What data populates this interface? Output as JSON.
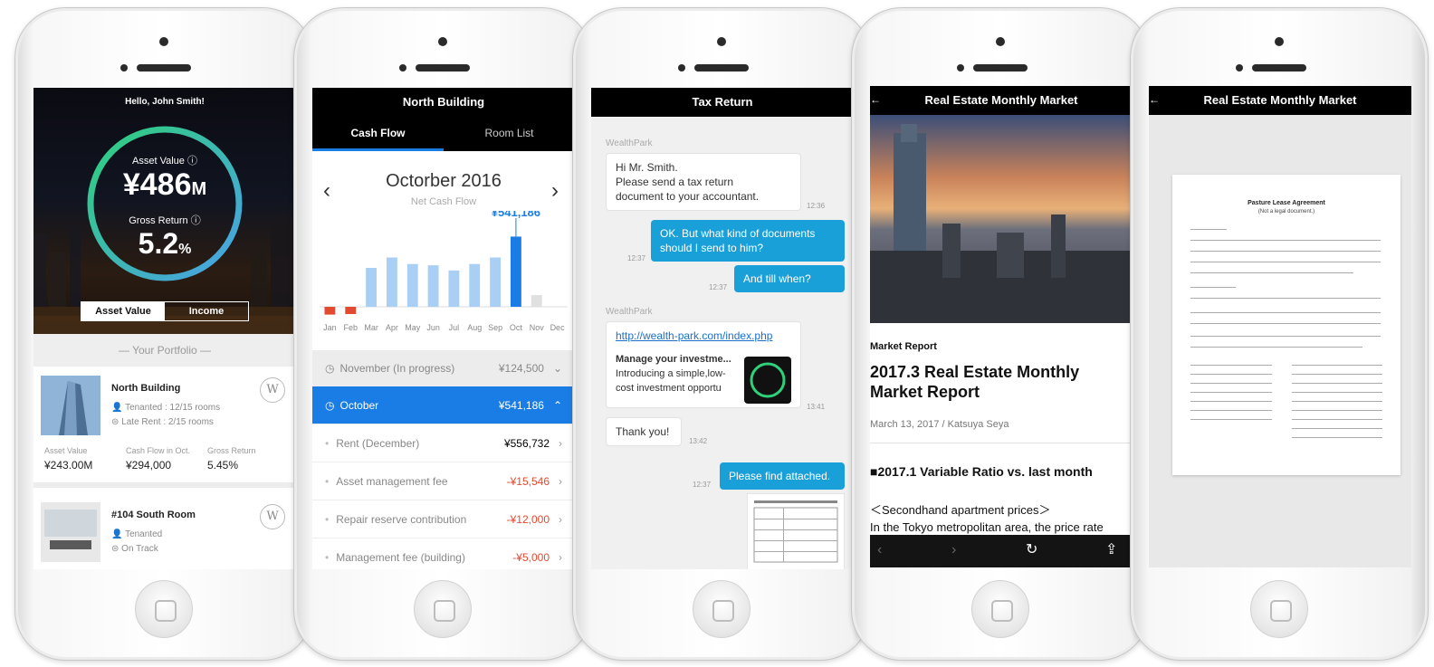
{
  "screens": {
    "portfolio": {
      "greeting": "Hello, John Smith!",
      "asset_value_label": "Asset Value",
      "asset_value": "¥486",
      "asset_value_unit": "M",
      "gross_return_label": "Gross Return",
      "gross_return": "5.2",
      "gross_return_unit": "%",
      "toggle": [
        "Asset Value",
        "Income"
      ],
      "section_title": "Your Portfolio",
      "properties": [
        {
          "name": "North Building",
          "line1": "Tenanted : 12/15 rooms",
          "line2": "Late Rent : 2/15 rooms",
          "stats": [
            {
              "k": "Asset Value",
              "v": "¥243.00M"
            },
            {
              "k": "Cash Flow in Oct.",
              "v": "¥294,000"
            },
            {
              "k": "Gross Return",
              "v": "5.45%"
            }
          ]
        },
        {
          "name": "#104 South Room",
          "line1": "Tenanted",
          "line2": "On Track"
        }
      ]
    },
    "cashflow": {
      "title": "North Building",
      "tabs": [
        "Cash Flow",
        "Room List"
      ],
      "month": "Octorber 2016",
      "subtitle": "Net Cash Flow",
      "callout": "¥541,186",
      "rows": [
        {
          "label": "November (In progress)",
          "value": "¥124,500"
        },
        {
          "label": "October",
          "value": "¥541,186"
        },
        {
          "label": "Rent (December)",
          "value": "¥556,732"
        },
        {
          "label": "Asset management fee",
          "value": "-¥15,546"
        },
        {
          "label": "Repair reserve contribution",
          "value": "-¥12,000"
        },
        {
          "label": "Management fee (building)",
          "value": "-¥5,000"
        }
      ]
    },
    "chat": {
      "title": "Tax Return",
      "sender": "WealthPark",
      "m1": "Hi Mr. Smith.",
      "m1b": "Please send a tax return",
      "m1c": "document to your accountant.",
      "t1": "12:36",
      "m2": "OK. But what kind of documents",
      "m2b": "should I send to him?",
      "t2": "12:37",
      "m3": "And till when?",
      "t3": "12:37",
      "link": "http://wealth-park.com/index.php",
      "preview_title": "Manage your investme...",
      "preview_body1": "Introducing a simple,low-",
      "preview_body2": "cost investment opportu",
      "t4": "13:41",
      "m5": "Thank you!",
      "t5": "13:42",
      "m6": "Please find attached.",
      "t6": "12:37"
    },
    "article": {
      "title": "Real Estate Monthly Market",
      "kicker": "Market Report",
      "headline1": "2017.3 Real Estate Monthly",
      "headline2": "Market Report",
      "byline": "March 13, 2017 / Katsuya Seya",
      "section": "■2017.1 Variable Ratio vs. last month",
      "p1": "＜Secondhand apartment prices＞",
      "p2": "In the Tokyo metropolitan area, the price rate"
    },
    "document": {
      "title": "Real Estate Monthly Market",
      "doc_title": "Pasture Lease Agreement",
      "doc_sub": "(Not a legal document.)"
    }
  },
  "chart_data": {
    "type": "bar",
    "categories": [
      "Jan",
      "Feb",
      "Mar",
      "Apr",
      "May",
      "Jun",
      "Jul",
      "Aug",
      "Sep",
      "Oct",
      "Nov",
      "Dec"
    ],
    "values": [
      -60000,
      -40000,
      300000,
      380000,
      330000,
      320000,
      280000,
      330000,
      380000,
      541186,
      90000,
      0
    ],
    "ylim": [
      -100000,
      600000
    ]
  },
  "colors": {
    "accent": "#1a7de6",
    "bar": "#a9cff5",
    "negative": "#e34a2f",
    "chat_out": "#1aa0d8"
  }
}
